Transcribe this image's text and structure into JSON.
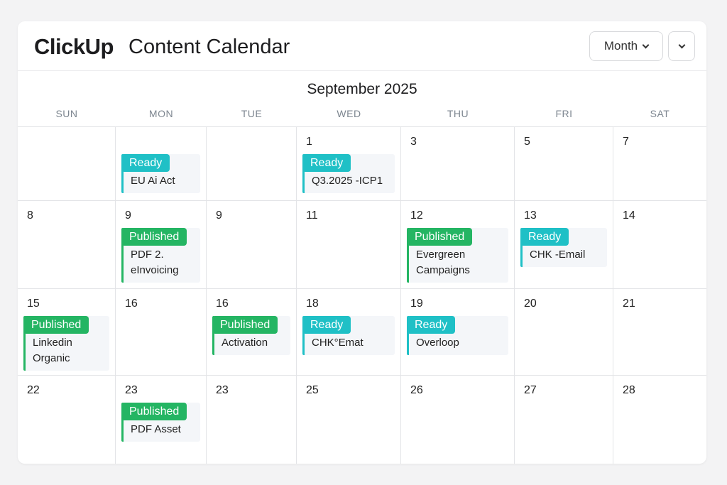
{
  "header": {
    "brand": "ClickUp",
    "title": "Content Calendar",
    "view_label": "Month"
  },
  "calendar": {
    "month_label": "September 2025",
    "weekdays": [
      "SUN",
      "MON",
      "TUE",
      "WED",
      "THU",
      "FRI",
      "SAT"
    ],
    "weeks": [
      [
        {
          "day": ""
        },
        {
          "day": "",
          "event": {
            "status": "Ready",
            "kind": "ready",
            "title": [
              "EU Ai Act"
            ]
          }
        },
        {
          "day": ""
        },
        {
          "day": "1",
          "event": {
            "status": "Ready",
            "kind": "ready",
            "title": [
              "Q3.2025 -ICP1"
            ]
          }
        },
        {
          "day": "3"
        },
        {
          "day": "5"
        },
        {
          "day": "7"
        }
      ],
      [
        {
          "day": "8"
        },
        {
          "day": "9",
          "event": {
            "status": "Published",
            "kind": "published",
            "title": [
              "PDF 2.",
              "eInvoicing"
            ]
          }
        },
        {
          "day": "9"
        },
        {
          "day": "11"
        },
        {
          "day": "12",
          "event": {
            "status": "Published",
            "kind": "published",
            "title": [
              "Evergreen",
              "Campaigns"
            ]
          }
        },
        {
          "day": "13",
          "event": {
            "status": "Ready",
            "kind": "ready",
            "title": [
              "CHK -Email"
            ]
          }
        },
        {
          "day": "14"
        }
      ],
      [
        {
          "day": "15",
          "event": {
            "status": "Published",
            "kind": "published",
            "title": [
              "Linkedin",
              "Organic"
            ]
          }
        },
        {
          "day": "16"
        },
        {
          "day": "16",
          "event": {
            "status": "Published",
            "kind": "published",
            "title": [
              "Activation"
            ]
          }
        },
        {
          "day": "18",
          "event": {
            "status": "Ready",
            "kind": "ready",
            "title": [
              "CHK°Emat"
            ]
          }
        },
        {
          "day": "19",
          "event": {
            "status": "Ready",
            "kind": "ready",
            "title": [
              "Overloop"
            ]
          }
        },
        {
          "day": "20"
        },
        {
          "day": "21"
        }
      ],
      [
        {
          "day": "22"
        },
        {
          "day": "23",
          "event": {
            "status": "Published",
            "kind": "published",
            "title": [
              "PDF Asset"
            ]
          }
        },
        {
          "day": "23"
        },
        {
          "day": "25"
        },
        {
          "day": "26"
        },
        {
          "day": "27"
        },
        {
          "day": "28"
        }
      ]
    ]
  },
  "colors": {
    "ready": "#1fc0c6",
    "published": "#24b563"
  },
  "icons": {
    "view_dropdown": "chevron-down-icon",
    "more_menu": "chevron-down-icon"
  }
}
